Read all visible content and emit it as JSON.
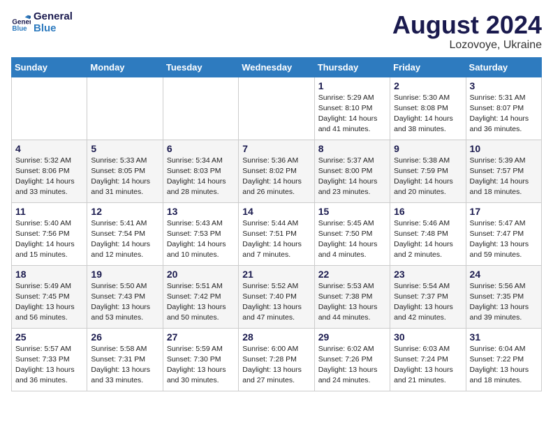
{
  "logo": {
    "line1": "General",
    "line2": "Blue"
  },
  "title": "August 2024",
  "subtitle": "Lozovoye, Ukraine",
  "days_of_week": [
    "Sunday",
    "Monday",
    "Tuesday",
    "Wednesday",
    "Thursday",
    "Friday",
    "Saturday"
  ],
  "weeks": [
    [
      {
        "day": "",
        "info": ""
      },
      {
        "day": "",
        "info": ""
      },
      {
        "day": "",
        "info": ""
      },
      {
        "day": "",
        "info": ""
      },
      {
        "day": "1",
        "info": "Sunrise: 5:29 AM\nSunset: 8:10 PM\nDaylight: 14 hours\nand 41 minutes."
      },
      {
        "day": "2",
        "info": "Sunrise: 5:30 AM\nSunset: 8:08 PM\nDaylight: 14 hours\nand 38 minutes."
      },
      {
        "day": "3",
        "info": "Sunrise: 5:31 AM\nSunset: 8:07 PM\nDaylight: 14 hours\nand 36 minutes."
      }
    ],
    [
      {
        "day": "4",
        "info": "Sunrise: 5:32 AM\nSunset: 8:06 PM\nDaylight: 14 hours\nand 33 minutes."
      },
      {
        "day": "5",
        "info": "Sunrise: 5:33 AM\nSunset: 8:05 PM\nDaylight: 14 hours\nand 31 minutes."
      },
      {
        "day": "6",
        "info": "Sunrise: 5:34 AM\nSunset: 8:03 PM\nDaylight: 14 hours\nand 28 minutes."
      },
      {
        "day": "7",
        "info": "Sunrise: 5:36 AM\nSunset: 8:02 PM\nDaylight: 14 hours\nand 26 minutes."
      },
      {
        "day": "8",
        "info": "Sunrise: 5:37 AM\nSunset: 8:00 PM\nDaylight: 14 hours\nand 23 minutes."
      },
      {
        "day": "9",
        "info": "Sunrise: 5:38 AM\nSunset: 7:59 PM\nDaylight: 14 hours\nand 20 minutes."
      },
      {
        "day": "10",
        "info": "Sunrise: 5:39 AM\nSunset: 7:57 PM\nDaylight: 14 hours\nand 18 minutes."
      }
    ],
    [
      {
        "day": "11",
        "info": "Sunrise: 5:40 AM\nSunset: 7:56 PM\nDaylight: 14 hours\nand 15 minutes."
      },
      {
        "day": "12",
        "info": "Sunrise: 5:41 AM\nSunset: 7:54 PM\nDaylight: 14 hours\nand 12 minutes."
      },
      {
        "day": "13",
        "info": "Sunrise: 5:43 AM\nSunset: 7:53 PM\nDaylight: 14 hours\nand 10 minutes."
      },
      {
        "day": "14",
        "info": "Sunrise: 5:44 AM\nSunset: 7:51 PM\nDaylight: 14 hours\nand 7 minutes."
      },
      {
        "day": "15",
        "info": "Sunrise: 5:45 AM\nSunset: 7:50 PM\nDaylight: 14 hours\nand 4 minutes."
      },
      {
        "day": "16",
        "info": "Sunrise: 5:46 AM\nSunset: 7:48 PM\nDaylight: 14 hours\nand 2 minutes."
      },
      {
        "day": "17",
        "info": "Sunrise: 5:47 AM\nSunset: 7:47 PM\nDaylight: 13 hours\nand 59 minutes."
      }
    ],
    [
      {
        "day": "18",
        "info": "Sunrise: 5:49 AM\nSunset: 7:45 PM\nDaylight: 13 hours\nand 56 minutes."
      },
      {
        "day": "19",
        "info": "Sunrise: 5:50 AM\nSunset: 7:43 PM\nDaylight: 13 hours\nand 53 minutes."
      },
      {
        "day": "20",
        "info": "Sunrise: 5:51 AM\nSunset: 7:42 PM\nDaylight: 13 hours\nand 50 minutes."
      },
      {
        "day": "21",
        "info": "Sunrise: 5:52 AM\nSunset: 7:40 PM\nDaylight: 13 hours\nand 47 minutes."
      },
      {
        "day": "22",
        "info": "Sunrise: 5:53 AM\nSunset: 7:38 PM\nDaylight: 13 hours\nand 44 minutes."
      },
      {
        "day": "23",
        "info": "Sunrise: 5:54 AM\nSunset: 7:37 PM\nDaylight: 13 hours\nand 42 minutes."
      },
      {
        "day": "24",
        "info": "Sunrise: 5:56 AM\nSunset: 7:35 PM\nDaylight: 13 hours\nand 39 minutes."
      }
    ],
    [
      {
        "day": "25",
        "info": "Sunrise: 5:57 AM\nSunset: 7:33 PM\nDaylight: 13 hours\nand 36 minutes."
      },
      {
        "day": "26",
        "info": "Sunrise: 5:58 AM\nSunset: 7:31 PM\nDaylight: 13 hours\nand 33 minutes."
      },
      {
        "day": "27",
        "info": "Sunrise: 5:59 AM\nSunset: 7:30 PM\nDaylight: 13 hours\nand 30 minutes."
      },
      {
        "day": "28",
        "info": "Sunrise: 6:00 AM\nSunset: 7:28 PM\nDaylight: 13 hours\nand 27 minutes."
      },
      {
        "day": "29",
        "info": "Sunrise: 6:02 AM\nSunset: 7:26 PM\nDaylight: 13 hours\nand 24 minutes."
      },
      {
        "day": "30",
        "info": "Sunrise: 6:03 AM\nSunset: 7:24 PM\nDaylight: 13 hours\nand 21 minutes."
      },
      {
        "day": "31",
        "info": "Sunrise: 6:04 AM\nSunset: 7:22 PM\nDaylight: 13 hours\nand 18 minutes."
      }
    ]
  ]
}
